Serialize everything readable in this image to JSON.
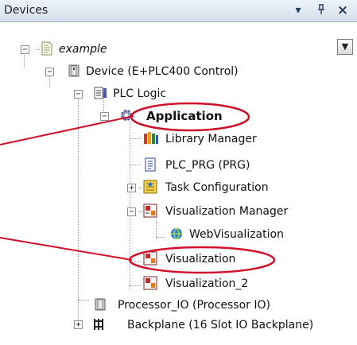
{
  "panel": {
    "title": "Devices",
    "buttons": [
      {
        "name": "dropdown-arrow-icon",
        "glyph": "▾"
      },
      {
        "name": "pin-icon",
        "glyph": "ᵮ"
      },
      {
        "name": "close-icon",
        "glyph": "×"
      }
    ]
  },
  "tree": {
    "root": "example",
    "device": "Device (E+PLC400 Control)",
    "plc_logic": "PLC Logic",
    "application": "Application",
    "library_manager": "Library Manager",
    "plc_prg": "PLC_PRG (PRG)",
    "task_configuration": "Task Configuration",
    "visualization_manager": "Visualization Manager",
    "web_visualization": "WebVisualization",
    "visualization": "Visualization",
    "visualization_2": "Visualization_2",
    "processor_io": "Processor_IO (Processor IO)",
    "backplane": "Backplane (16 Slot IO Backplane)"
  },
  "toggles": {
    "expanded": "−",
    "collapsed": "+"
  },
  "annotation_color": "#d0102a"
}
